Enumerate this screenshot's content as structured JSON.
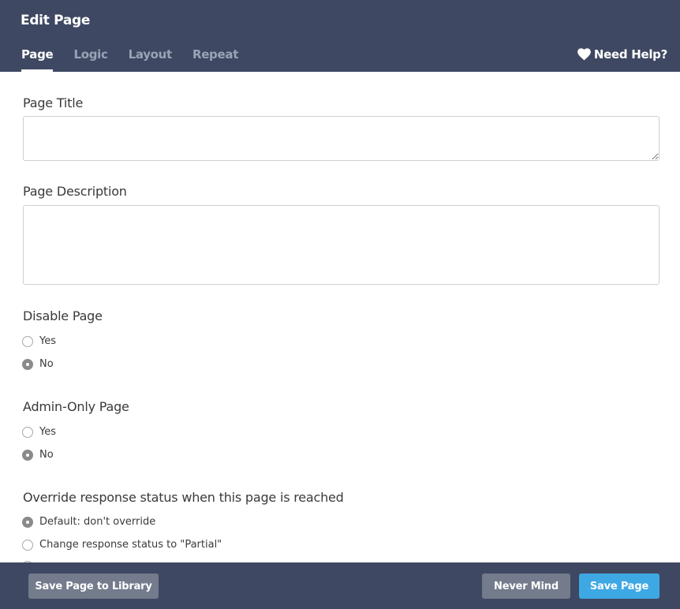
{
  "modal": {
    "title": "Edit Page"
  },
  "tabs": [
    {
      "label": "Page",
      "active": true
    },
    {
      "label": "Logic",
      "active": false
    },
    {
      "label": "Layout",
      "active": false
    },
    {
      "label": "Repeat",
      "active": false
    }
  ],
  "help": {
    "label": "Need Help?",
    "icon": "heart-icon"
  },
  "form": {
    "page_title": {
      "label": "Page Title",
      "value": ""
    },
    "page_description": {
      "label": "Page Description",
      "value": ""
    },
    "disable_page": {
      "label": "Disable Page",
      "options": [
        {
          "label": "Yes",
          "checked": false
        },
        {
          "label": "No",
          "checked": true
        }
      ]
    },
    "admin_only": {
      "label": "Admin-Only Page",
      "options": [
        {
          "label": "Yes",
          "checked": false
        },
        {
          "label": "No",
          "checked": true
        }
      ]
    },
    "override_status": {
      "label": "Override response status when this page is reached",
      "options": [
        {
          "label": "Default: don't override",
          "checked": true
        },
        {
          "label": "Change response status to \"Partial\"",
          "checked": false
        }
      ]
    }
  },
  "footer": {
    "save_to_library": "Save Page to Library",
    "never_mind": "Never Mind",
    "save_page": "Save Page"
  },
  "colors": {
    "header_bg": "#3e4862",
    "primary_button": "#3ea8e5",
    "secondary_button": "#737b8c"
  }
}
